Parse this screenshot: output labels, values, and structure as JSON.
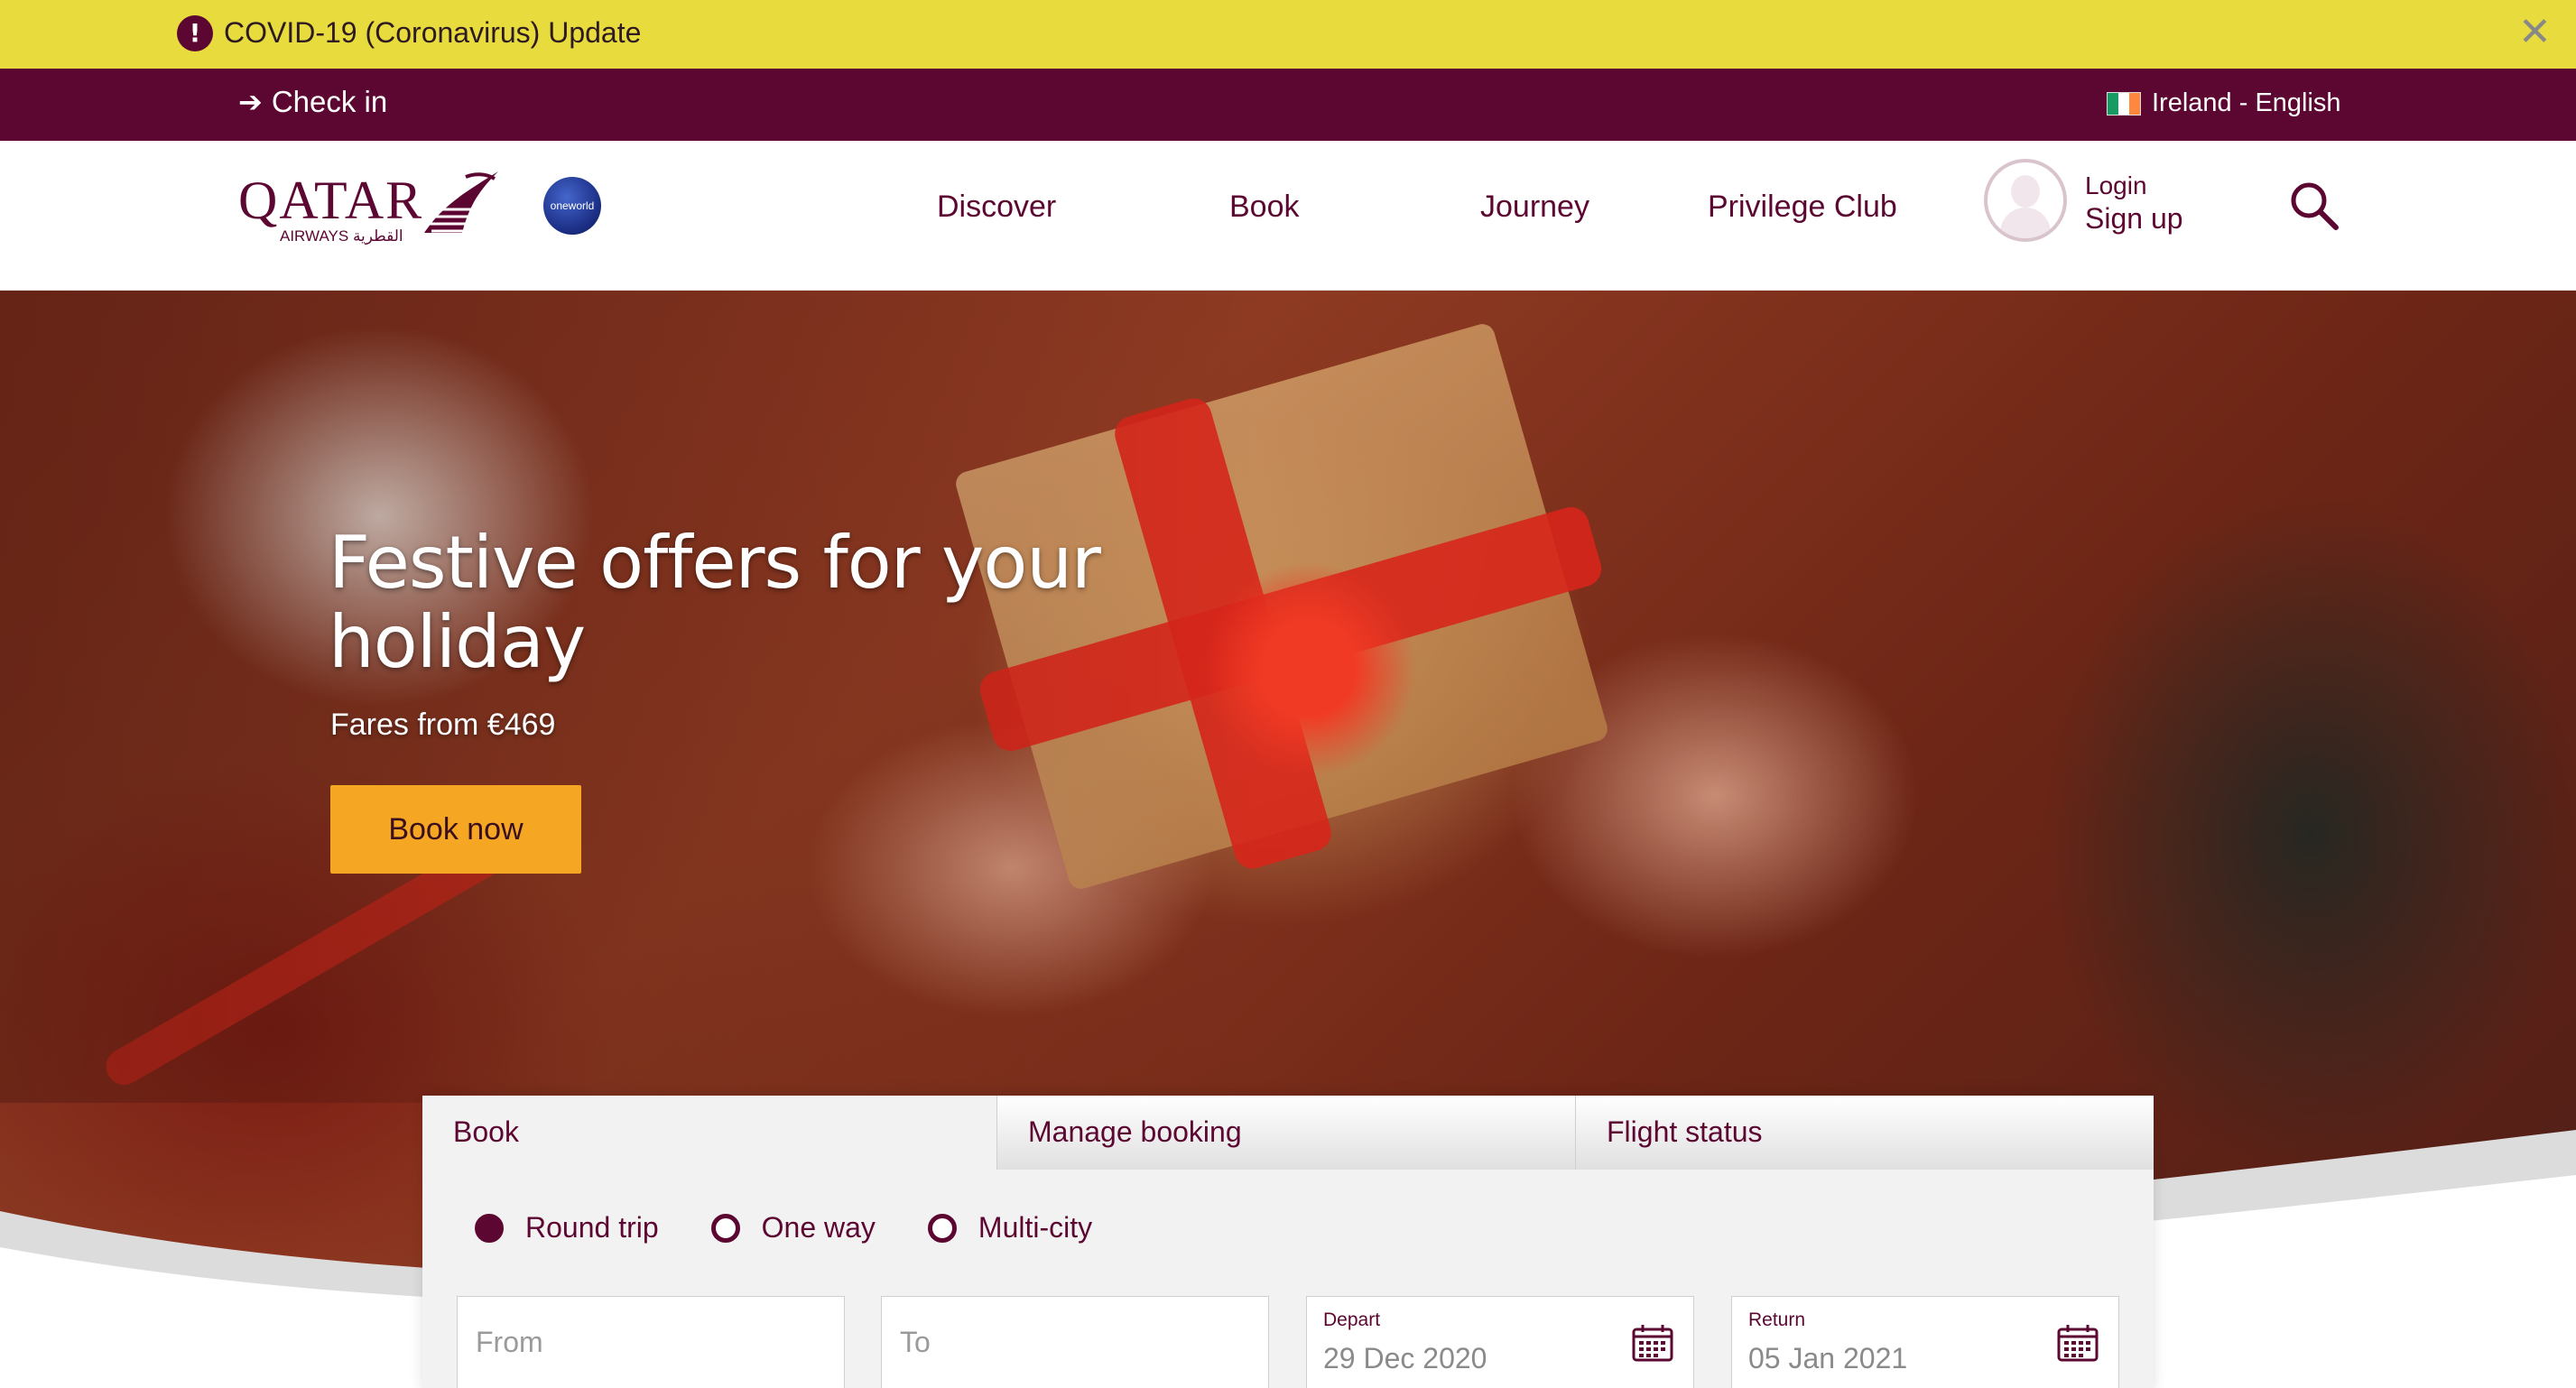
{
  "covid_banner": {
    "text": "COVID-19 (Coronavirus) Update",
    "warning_glyph": "!",
    "close_glyph": "✕"
  },
  "topbar": {
    "checkin_label": "Check in",
    "locale": "Ireland - English",
    "arrow_glyph": "➔"
  },
  "brand": {
    "name": "QATAR",
    "subtitle": "AIRWAYS القطرية",
    "alliance": "oneworld"
  },
  "nav": {
    "items": [
      "Discover",
      "Book",
      "Journey",
      "Privilege Club"
    ]
  },
  "account": {
    "login_label": "Login",
    "signup_label": "Sign up"
  },
  "hero": {
    "title": "Festive offers for your holiday",
    "subtitle": "Fares from €469",
    "cta_label": "Book now"
  },
  "booking": {
    "tabs": [
      "Book",
      "Manage booking",
      "Flight status"
    ],
    "active_tab": "Book",
    "trip_types": [
      "Round trip",
      "One way",
      "Multi-city"
    ],
    "selected_trip_type": "Round trip",
    "from_placeholder": "From",
    "to_placeholder": "To",
    "depart_label": "Depart",
    "depart_value": "29 Dec 2020",
    "return_label": "Return",
    "return_value": "05 Jan 2021"
  },
  "colors": {
    "brand_maroon": "#5c0632",
    "banner_yellow": "#e7db3d",
    "cta_orange": "#f5a623"
  },
  "icons": [
    "warning-icon",
    "close-icon",
    "arrow-right-icon",
    "ireland-flag-icon",
    "qatar-logo",
    "oneworld-logo",
    "user-avatar-icon",
    "search-icon",
    "calendar-icon"
  ]
}
